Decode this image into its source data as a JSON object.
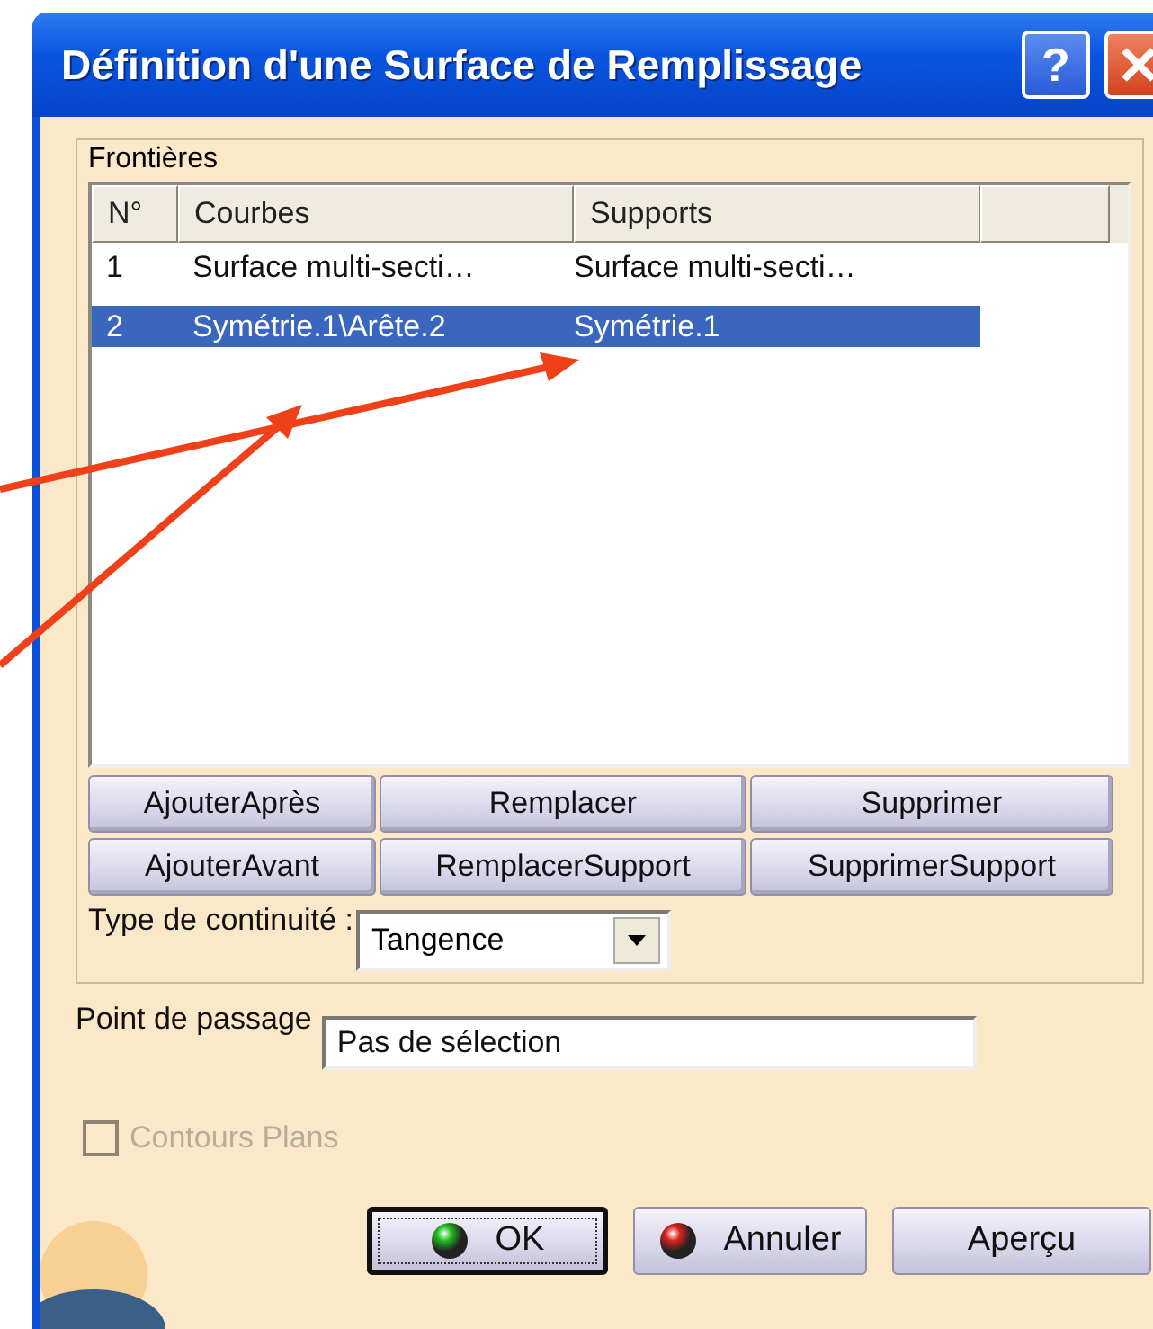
{
  "window": {
    "title": "Définition d'une Surface de Remplissage",
    "help_button": "?"
  },
  "group": {
    "title": "Frontières"
  },
  "table": {
    "columns": [
      "N°",
      "Courbes",
      "Supports"
    ],
    "rows": [
      {
        "cells": [
          "1",
          "Surface multi-secti…",
          "Surface multi-secti…"
        ],
        "selected": false
      },
      {
        "cells": [
          "2",
          "Symétrie.1\\Arête.2",
          "Symétrie.1"
        ],
        "selected": true
      }
    ]
  },
  "list_buttons": [
    [
      "AjouterAprès",
      "Remplacer",
      "Supprimer"
    ],
    [
      "AjouterAvant",
      "RemplacerSupport",
      "SupprimerSupport"
    ]
  ],
  "continuity": {
    "label": "Type de continuité :",
    "value": "Tangence"
  },
  "passage": {
    "label": "Point de passage",
    "value": "Pas de sélection"
  },
  "planar_contours": {
    "label": "Contours Plans",
    "checked": false,
    "disabled": true
  },
  "dialog_buttons": [
    {
      "label": "OK",
      "kind": "ok",
      "default": true
    },
    {
      "label": "Annuler",
      "kind": "cancel",
      "default": false
    },
    {
      "label": "Aperçu",
      "kind": "plain",
      "default": false
    }
  ]
}
